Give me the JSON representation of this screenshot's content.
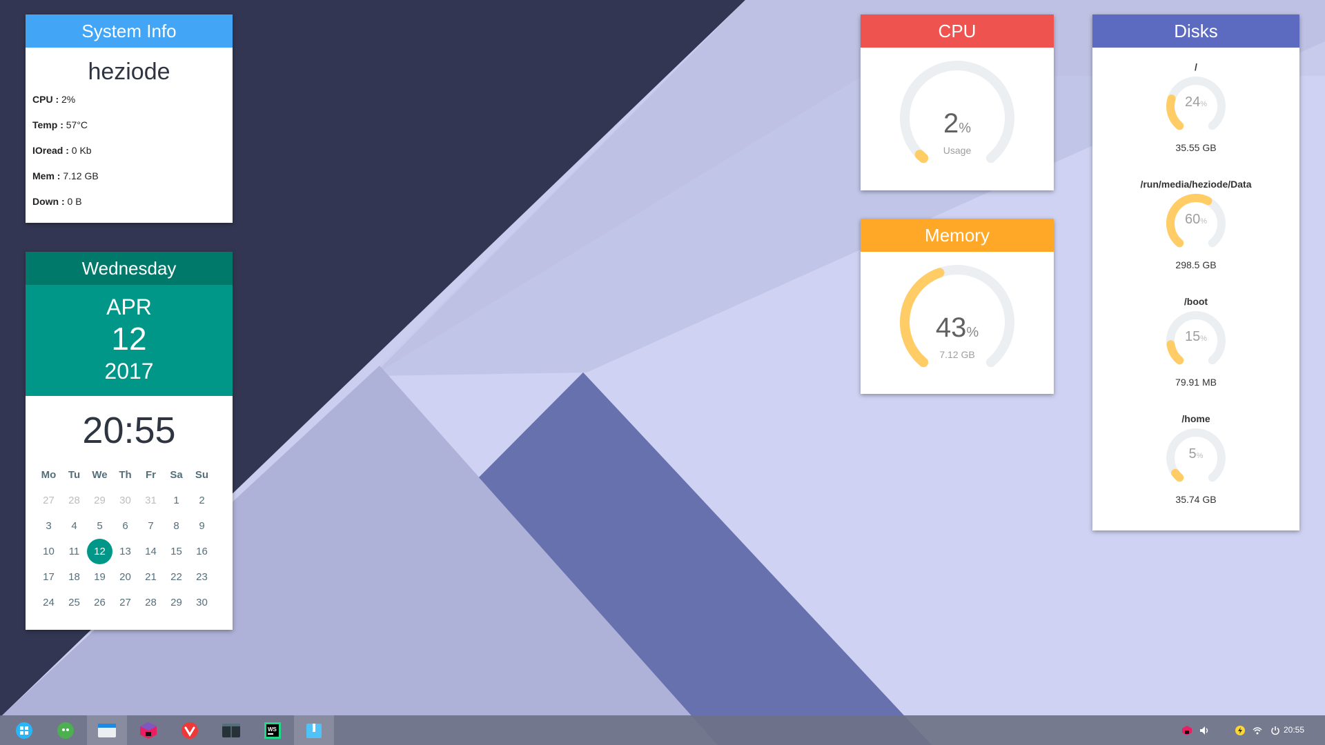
{
  "system_info": {
    "title": "System Info",
    "hostname": "heziode",
    "stats": [
      {
        "label": "CPU :",
        "value": "2%"
      },
      {
        "label": "Temp :",
        "value": "57°C"
      },
      {
        "label": "IOread :",
        "value": "0 Kb"
      },
      {
        "label": "Mem :",
        "value": "7.12 GB"
      },
      {
        "label": "Down :",
        "value": "0 B"
      }
    ]
  },
  "calendar": {
    "weekday": "Wednesday",
    "month": "APR",
    "day": "12",
    "year": "2017",
    "time": "20:55",
    "headers": [
      "Mo",
      "Tu",
      "We",
      "Th",
      "Fr",
      "Sa",
      "Su"
    ],
    "weeks": [
      [
        "27",
        "28",
        "29",
        "30",
        "31",
        "1",
        "2"
      ],
      [
        "3",
        "4",
        "5",
        "6",
        "7",
        "8",
        "9"
      ],
      [
        "10",
        "11",
        "12",
        "13",
        "14",
        "15",
        "16"
      ],
      [
        "17",
        "18",
        "19",
        "20",
        "21",
        "22",
        "23"
      ],
      [
        "24",
        "25",
        "26",
        "27",
        "28",
        "29",
        "30"
      ]
    ],
    "muted_first_week_count": 5,
    "today": "12"
  },
  "cpu": {
    "title": "CPU",
    "percent": 2,
    "percent_label": "2",
    "unit": "%",
    "subtitle": "Usage"
  },
  "memory": {
    "title": "Memory",
    "percent": 43,
    "percent_label": "43",
    "unit": "%",
    "subtitle": "7.12 GB"
  },
  "disks": {
    "title": "Disks",
    "items": [
      {
        "mount": "/",
        "percent": 24,
        "percent_label": "24",
        "unit": "%",
        "size": "35.55 GB"
      },
      {
        "mount": "/run/media/heziode/Data",
        "percent": 60,
        "percent_label": "60",
        "unit": "%",
        "size": "298.5 GB"
      },
      {
        "mount": "/boot",
        "percent": 15,
        "percent_label": "15",
        "unit": "%",
        "size": "79.91 MB"
      },
      {
        "mount": "/home",
        "percent": 5,
        "percent_label": "5",
        "unit": "%",
        "size": "35.74 GB"
      }
    ]
  },
  "colors": {
    "sysinfo_header": "#42a5f5",
    "calendar_header": "#00796b",
    "calendar_accent": "#009688",
    "cpu_header": "#ef5350",
    "memory_header": "#ffa726",
    "disks_header": "#5c6bc0",
    "gauge_fill": "#ffcc66",
    "gauge_track": "#eceff1"
  },
  "taskbar": {
    "apps": [
      {
        "icon": "launcher-icon"
      },
      {
        "icon": "wechat-icon"
      },
      {
        "icon": "file-manager-icon"
      },
      {
        "icon": "jetbrains-toolbox-icon"
      },
      {
        "icon": "vivaldi-icon"
      },
      {
        "icon": "terminal-icon"
      },
      {
        "icon": "webstorm-icon"
      },
      {
        "icon": "archive-manager-icon"
      }
    ],
    "tray": [
      "toolbox-tray-icon",
      "volume-icon",
      "power-plug-icon",
      "wifi-icon",
      "shutdown-icon"
    ],
    "time": "20:55"
  }
}
